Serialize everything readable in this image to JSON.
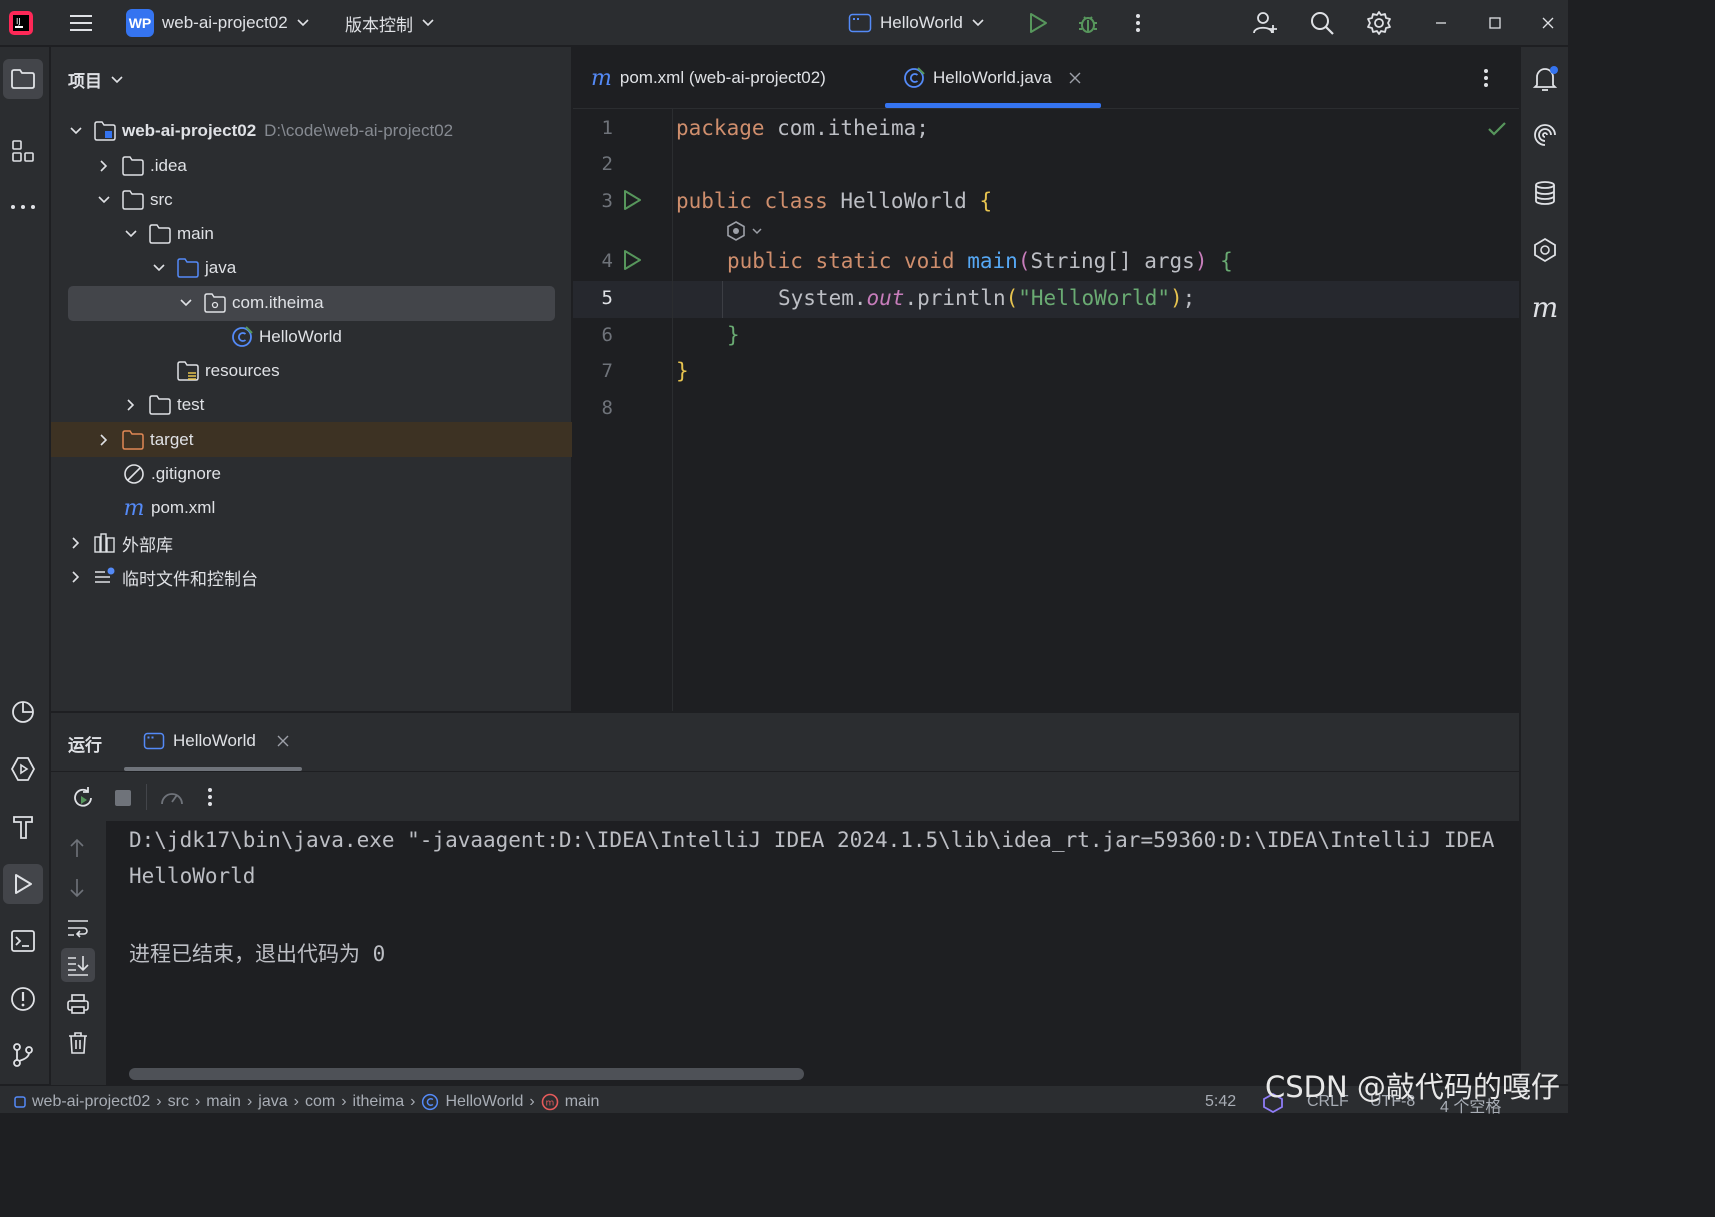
{
  "titlebar": {
    "project_badge": "WP",
    "project_name": "web-ai-project02",
    "vcs_label": "版本控制",
    "run_config": "HelloWorld"
  },
  "project_panel": {
    "title": "项目",
    "root_name": "web-ai-project02",
    "root_path": "D:\\code\\web-ai-project02",
    "items": [
      {
        "label": ".idea"
      },
      {
        "label": "src"
      },
      {
        "label": "main"
      },
      {
        "label": "java"
      },
      {
        "label": "com.itheima"
      },
      {
        "label": "HelloWorld"
      },
      {
        "label": "resources"
      },
      {
        "label": "test"
      },
      {
        "label": "target"
      },
      {
        "label": ".gitignore"
      },
      {
        "label": "pom.xml"
      },
      {
        "label": "外部库"
      },
      {
        "label": "临时文件和控制台"
      }
    ]
  },
  "editor": {
    "tabs": [
      {
        "label": "pom.xml (web-ai-project02)"
      },
      {
        "label": "HelloWorld.java"
      }
    ],
    "line_numbers": [
      "1",
      "2",
      "3",
      "4",
      "5",
      "6",
      "7",
      "8"
    ],
    "code": {
      "l1_kw": "package",
      "l1_rest": " com.itheima;",
      "l3_kw": "public class",
      "l3_name": " HelloWorld ",
      "l3_brace": "{",
      "l4_kw": "public static void",
      "l4_fn": "main",
      "l4_p1": "(",
      "l4_args": "String[] args",
      "l4_p2": ")",
      "l4_brace": " {",
      "l5_a": "System.",
      "l5_out": "out",
      "l5_b": ".println",
      "l5_p1": "(",
      "l5_str": "\"HelloWorld\"",
      "l5_p2": ")",
      "l5_c": ";",
      "l6": "}",
      "l7": "}"
    }
  },
  "run_panel": {
    "title": "运行",
    "tab_label": "HelloWorld",
    "console_lines": [
      "D:\\jdk17\\bin\\java.exe \"-javaagent:D:\\IDEA\\IntelliJ IDEA 2024.1.5\\lib\\idea_rt.jar=59360:D:\\IDEA\\IntelliJ IDEA",
      "HelloWorld",
      "进程已结束，退出代码为 0"
    ]
  },
  "statusbar": {
    "breadcrumbs": [
      "web-ai-project02",
      "src",
      "main",
      "java",
      "com",
      "itheima",
      "HelloWorld",
      "main"
    ],
    "position": "5:42",
    "line_sep": "CRLF",
    "encoding": "UTF-8",
    "indent": "4 个空格"
  },
  "watermark": "CSDN @敲代码的嘎仔",
  "colors": {
    "accent": "#3574f0",
    "run_green": "#57965c",
    "keyword": "#cf8e6d",
    "function": "#56a8f5",
    "string": "#6aab73"
  }
}
